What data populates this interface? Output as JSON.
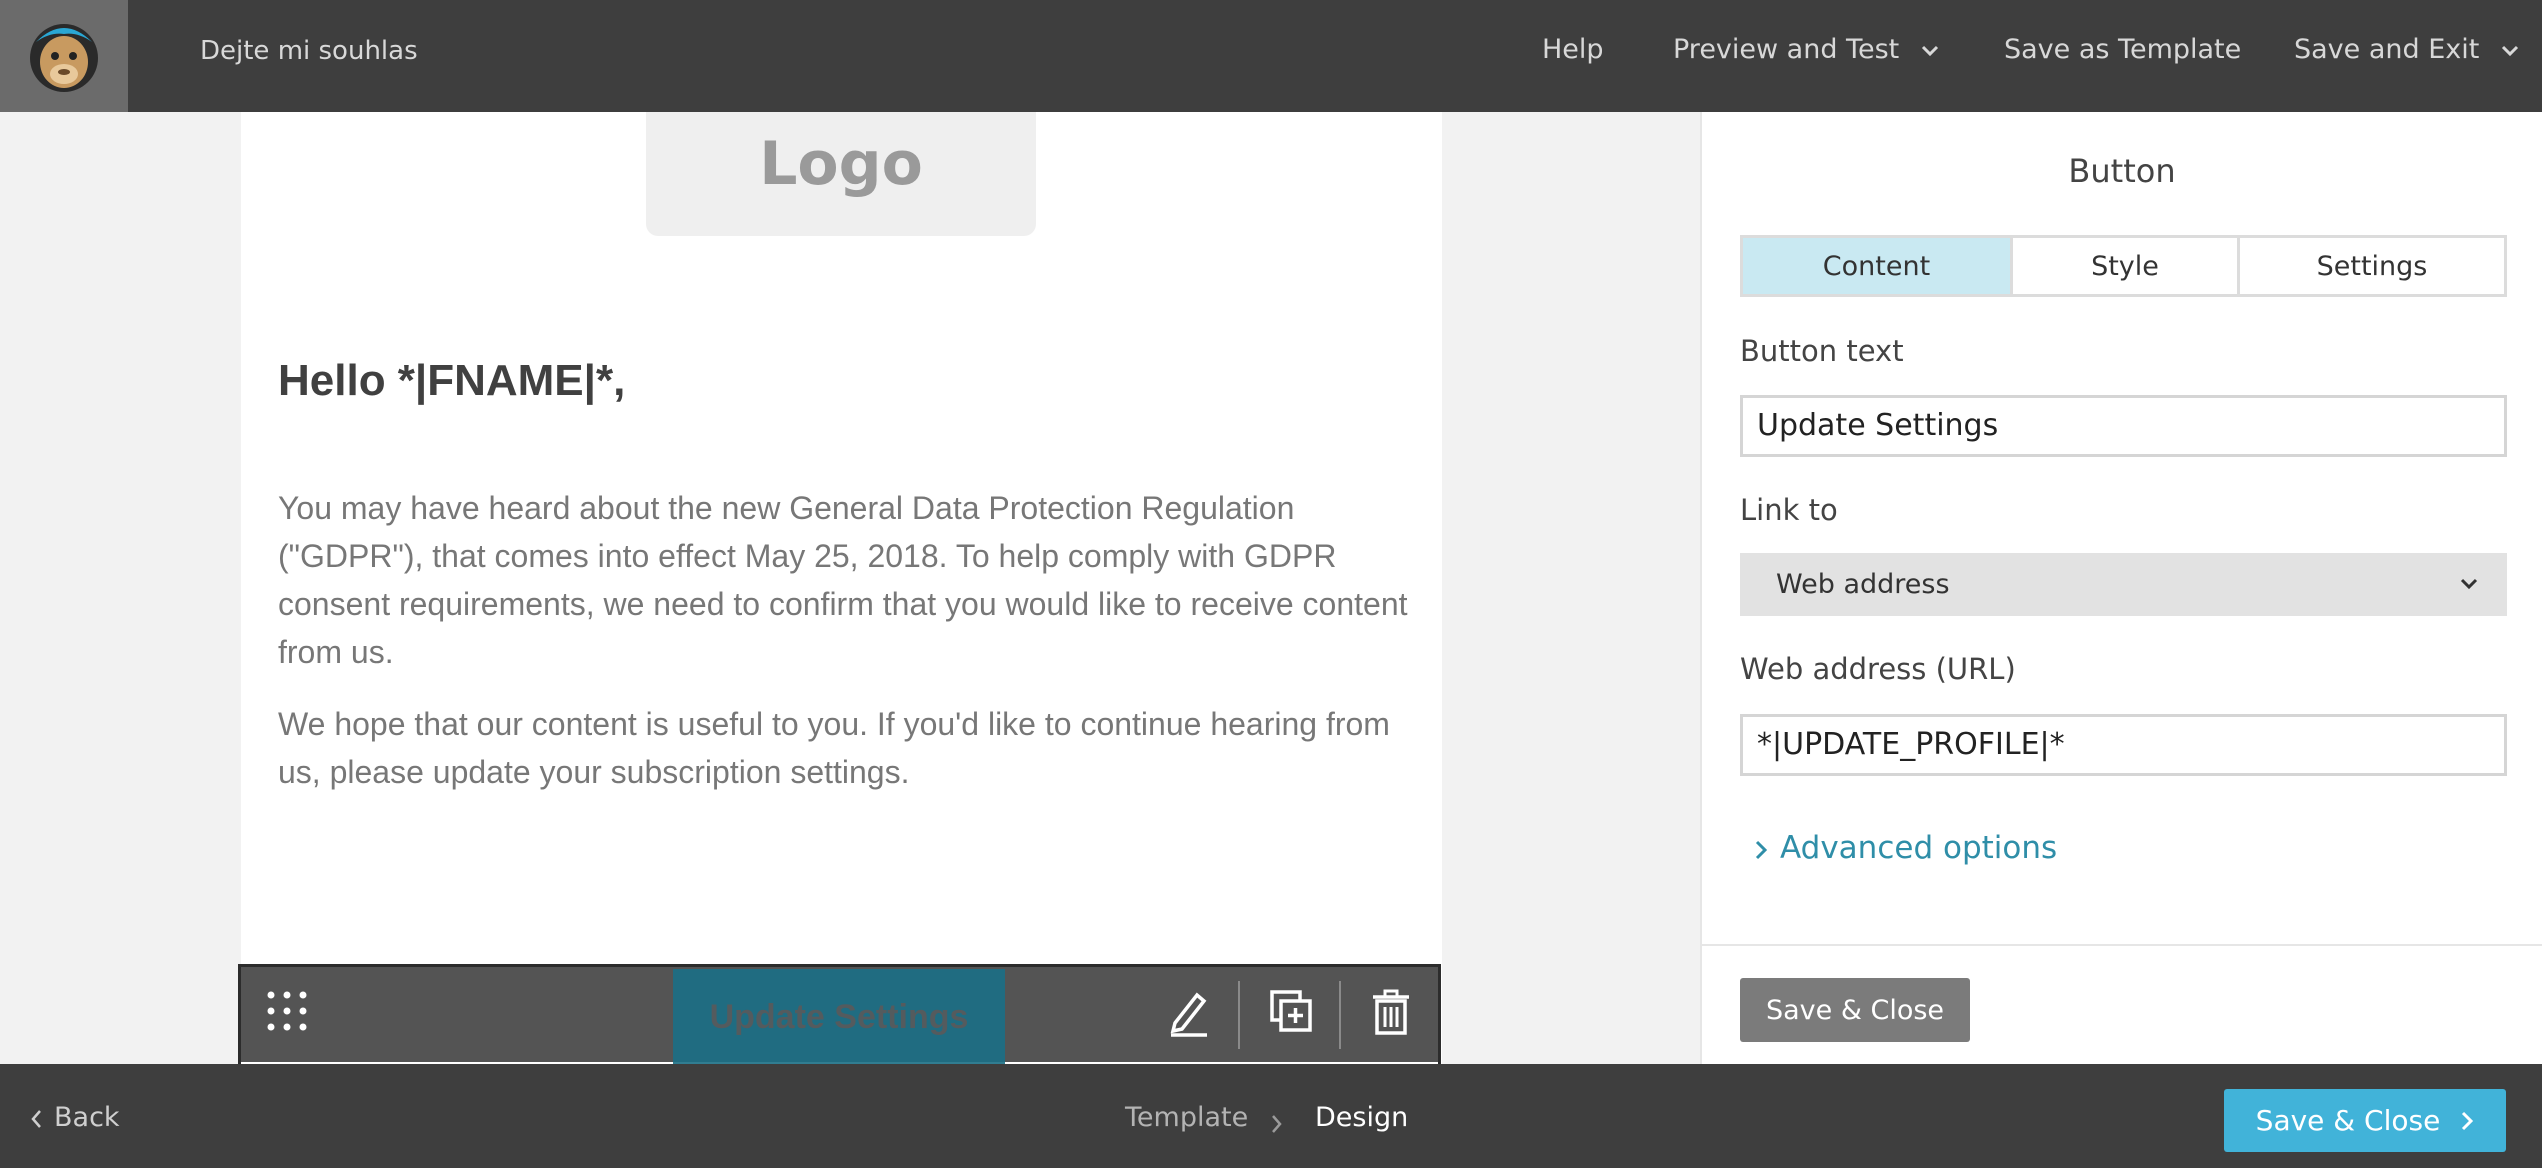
{
  "header": {
    "campaign_name": "Dejte mi souhlas",
    "nav": {
      "help": "Help",
      "preview": "Preview and Test",
      "save_template": "Save as Template",
      "save_exit": "Save and Exit"
    }
  },
  "email": {
    "logo_placeholder": "Logo",
    "greeting": "Hello *|FNAME|*,",
    "paragraph1": "You may have heard about the new General Data Protection Regulation (\"GDPR\"), that comes into effect May 25, 2018. To help comply with GDPR consent requirements, we need to confirm that you would like to receive content from us.",
    "paragraph2": "We hope that our content is useful to you. If you'd like to continue hearing from us, please update your subscription settings.",
    "button_label": "Update Settings"
  },
  "panel": {
    "title": "Button",
    "tabs": [
      "Content",
      "Style",
      "Settings"
    ],
    "active_tab": "Content",
    "button_text_label": "Button text",
    "button_text_value": "Update Settings",
    "link_to_label": "Link to",
    "link_to_value": "Web address",
    "url_label": "Web address (URL)",
    "url_value": "*|UPDATE_PROFILE|*",
    "advanced": "Advanced options",
    "save_close": "Save & Close"
  },
  "footer": {
    "back": "Back",
    "crumbs": [
      "Template",
      "Design"
    ],
    "save_close": "Save & Close"
  },
  "colors": {
    "accent": "#41b3d9",
    "topbar": "#3e3e3e",
    "active_tab": "#c9e9f2",
    "link": "#2f8ea8"
  },
  "icons": [
    "mailchimp-logo-icon",
    "chevron-down-icon",
    "drag-handle-icon",
    "pencil-icon",
    "duplicate-icon",
    "trash-icon",
    "chevron-right-icon",
    "chevron-left-icon"
  ]
}
